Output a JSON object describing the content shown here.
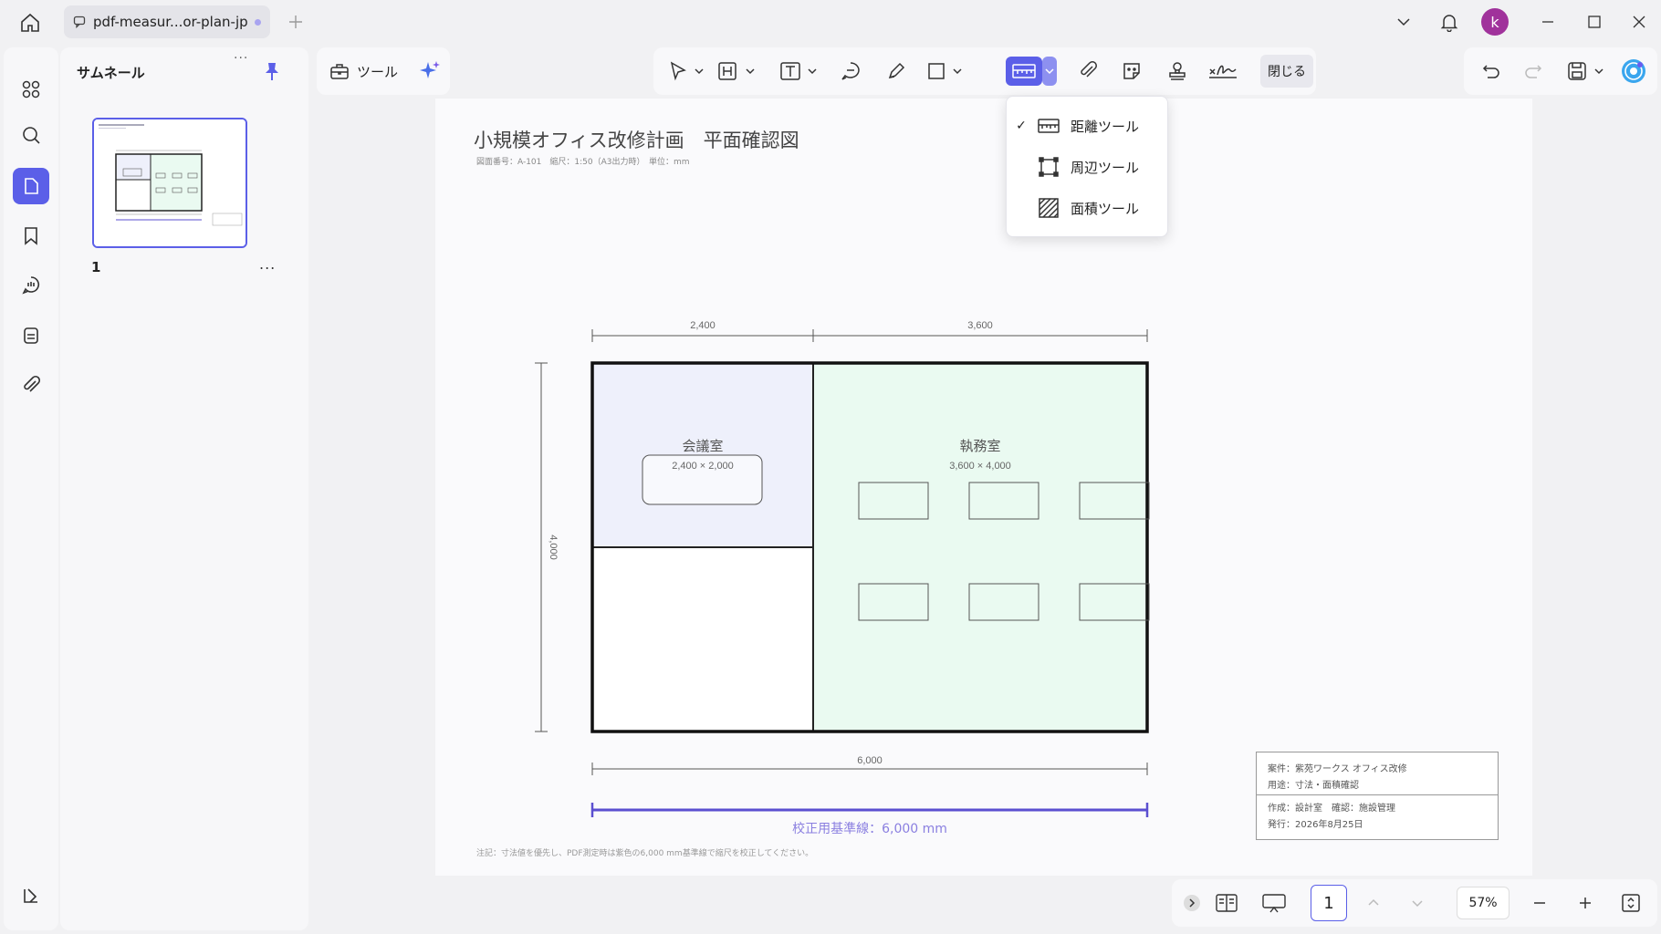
{
  "window": {
    "tab_title": "pdf-measur...or-plan-jp",
    "avatar_letter": "k"
  },
  "sidebar": {
    "panel_title": "サムネール",
    "grip": "...",
    "thumbnail_page_number": "1",
    "thumbnail_more": "...",
    "rail_items": [
      "grid-icon",
      "search-icon",
      "page-icon",
      "bookmark-icon",
      "comment-icon",
      "form-icon",
      "attachment-icon",
      "panel-toggle-icon"
    ]
  },
  "toolbar": {
    "tools_label": "ツール",
    "close_label": "閉じる",
    "accent_color": "#5b5fe8"
  },
  "measure_menu": {
    "items": [
      {
        "label": "距離ツール",
        "checked": true,
        "icon": "distance-ruler-icon"
      },
      {
        "label": "周辺ツール",
        "checked": false,
        "icon": "perimeter-icon"
      },
      {
        "label": "面積ツール",
        "checked": false,
        "icon": "area-hatch-icon"
      }
    ],
    "check_mark": "✓"
  },
  "document": {
    "title": "小規模オフィス改修計画　平面確認図",
    "subtitle": "図面番号：A-101　縮尺：1:50（A3出力時）　単位：mm",
    "dims": {
      "top_left": "2,400",
      "top_right": "3,600",
      "left_vertical": "4,000",
      "bottom_total": "6,000"
    },
    "rooms": {
      "meeting_name": "会議室",
      "meeting_size": "2,400 × 2,000",
      "office_name": "執務室",
      "office_size": "3,600 × 4,000"
    },
    "calibration_label": "校正用基準線：6,000 mm",
    "note": "注記：寸法値を優先し、PDF測定時は紫色の6,000 mm基準線で縮尺を校正してください。",
    "titleblock": {
      "line1": "案件：紫苑ワークス オフィス改修",
      "line2": "用途：寸法・面積確認",
      "line3": "作成：設計室　確認：施設管理",
      "line4": "発行：2026年8月25日"
    },
    "colors": {
      "meeting_fill": "#eef0fb",
      "office_fill": "#eafaf1",
      "calibration_line": "#5b4fd0"
    }
  },
  "bottom": {
    "page_number": "1",
    "zoom": "57%"
  }
}
